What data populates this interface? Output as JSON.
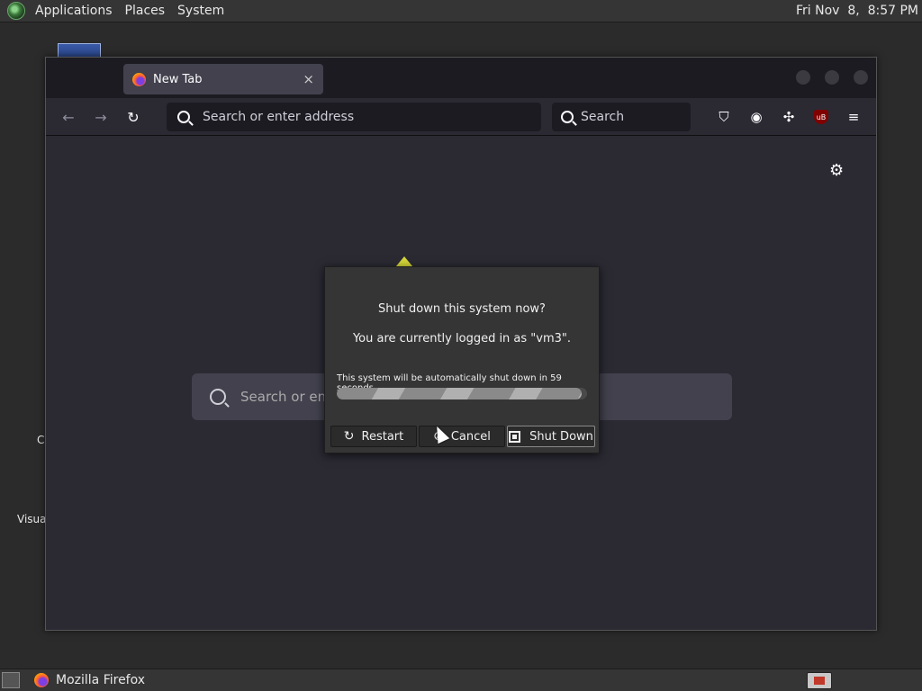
{
  "top_panel": {
    "menus": [
      "Applications",
      "Places",
      "System"
    ],
    "clock": "Fri Nov  8,  8:57 PM"
  },
  "desktop": {
    "labels": [
      "C",
      "Visua"
    ]
  },
  "browser": {
    "tab_title": "New Tab",
    "tab_close": "×",
    "url_placeholder": "Search or enter address",
    "search_placeholder": "Search",
    "newtab_search_placeholder": "Search or ente",
    "ublock_badge": "uB",
    "icons": {
      "back": "←",
      "forward": "→",
      "reload": "↻",
      "pocket": "⛉",
      "account": "◉",
      "extensions": "✣",
      "menu": "≡",
      "settings": "⚙"
    }
  },
  "dialog": {
    "question": "Shut down this system now?",
    "logged_in": "You are currently logged in as \"vm3\".",
    "countdown": "This system will be automatically shut down in 59 seconds",
    "progress_fraction": 0.98,
    "buttons": {
      "restart": "Restart",
      "cancel": "Cancel",
      "shutdown": "Shut Down"
    },
    "icons": {
      "restart": "↻",
      "cancel": "⊘"
    }
  },
  "taskbar": {
    "window_title": "Mozilla Firefox"
  }
}
